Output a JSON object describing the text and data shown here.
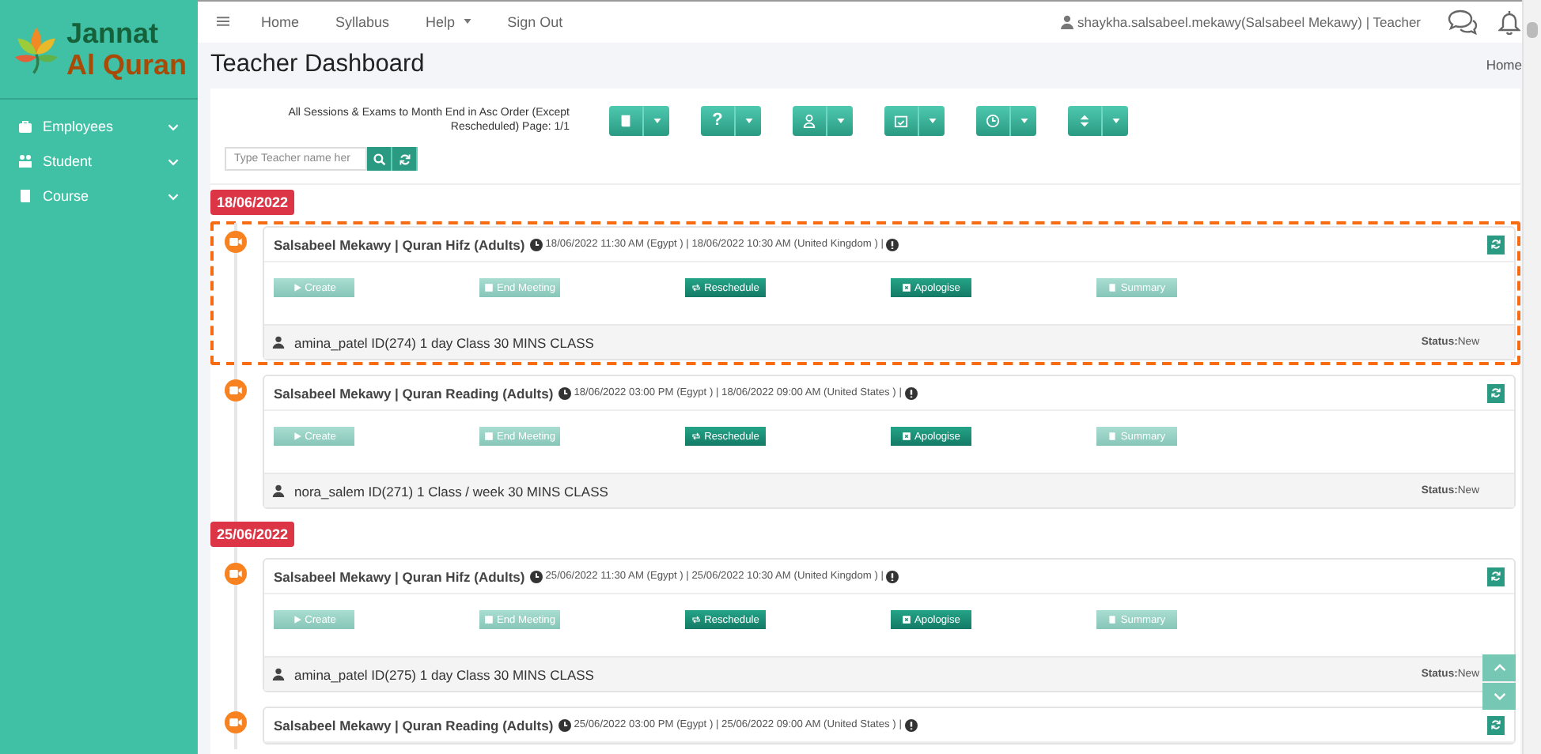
{
  "logo": {
    "line_1": "Jannat",
    "line_2": "Al Quran"
  },
  "sidebar": {
    "items": [
      {
        "label": "Employees",
        "kind": "briefcase"
      },
      {
        "label": "Student",
        "kind": "people"
      },
      {
        "label": "Course",
        "kind": "book"
      }
    ]
  },
  "nav": {
    "links": [
      {
        "label": "Home",
        "dropdown": false
      },
      {
        "label": "Syllabus",
        "dropdown": false
      },
      {
        "label": "Help",
        "dropdown": true
      },
      {
        "label": "Sign Out",
        "dropdown": false
      }
    ],
    "user": "shaykha.salsabeel.mekawy(Salsabeel Mekawy) | Teacher"
  },
  "page": {
    "title": "Teacher Dashboard",
    "breadcrumb": "Home"
  },
  "toolbar": {
    "caption": "All Sessions & Exams to Month End in Asc Order (Except Rescheduled) Page: 1/1",
    "groups": [
      {
        "kind": "book"
      },
      {
        "kind": "help",
        "label": "?"
      },
      {
        "kind": "user"
      },
      {
        "kind": "calendar"
      },
      {
        "kind": "clock"
      },
      {
        "kind": "sort"
      }
    ]
  },
  "search": {
    "placeholder": "Type Teacher name her"
  },
  "days": [
    {
      "date": "18/06/2022",
      "sessions": [
        {
          "highlighted": true,
          "title": "Salsabeel Mekawy | Quran Hifz (Adults)",
          "time": "18/06/2022 11:30 AM (Egypt ) | 18/06/2022 10:30 AM (United Kingdom ) |",
          "buttons": [
            {
              "label": "Create",
              "kind": "play",
              "disabled": true
            },
            {
              "label": "End Meeting",
              "kind": "stop",
              "disabled": true
            },
            {
              "label": "Reschedule",
              "kind": "repeat",
              "disabled": false
            },
            {
              "label": "Apologise",
              "kind": "cancel",
              "disabled": false
            },
            {
              "label": "Summary",
              "kind": "book",
              "disabled": true
            }
          ],
          "student": "amina_patel ID(274) 1 day Class 30 MINS CLASS",
          "status": "**Status:**New"
        },
        {
          "highlighted": false,
          "title": "Salsabeel Mekawy | Quran Reading (Adults)",
          "time": "18/06/2022 03:00 PM (Egypt ) | 18/06/2022 09:00 AM (United States ) |",
          "buttons": [
            {
              "label": "Create",
              "kind": "play",
              "disabled": true
            },
            {
              "label": "End Meeting",
              "kind": "stop",
              "disabled": true
            },
            {
              "label": "Reschedule",
              "kind": "repeat",
              "disabled": false
            },
            {
              "label": "Apologise",
              "kind": "cancel",
              "disabled": false
            },
            {
              "label": "Summary",
              "kind": "book",
              "disabled": true
            }
          ],
          "student": "nora_salem ID(271) 1 Class / week 30 MINS CLASS",
          "status": "**Status:**New"
        }
      ]
    },
    {
      "date": "25/06/2022",
      "sessions": [
        {
          "highlighted": false,
          "title": "Salsabeel Mekawy | Quran Hifz (Adults)",
          "time": "25/06/2022 11:30 AM (Egypt ) | 25/06/2022 10:30 AM (United Kingdom ) |",
          "buttons": [
            {
              "label": "Create",
              "kind": "play",
              "disabled": true
            },
            {
              "label": "End Meeting",
              "kind": "stop",
              "disabled": true
            },
            {
              "label": "Reschedule",
              "kind": "repeat",
              "disabled": false
            },
            {
              "label": "Apologise",
              "kind": "cancel",
              "disabled": false
            },
            {
              "label": "Summary",
              "kind": "book",
              "disabled": true
            }
          ],
          "student": "amina_patel ID(275) 1 day Class 30 MINS CLASS",
          "status": "**Status:**New"
        },
        {
          "highlighted": false,
          "title": "Salsabeel Mekawy | Quran Reading (Adults)",
          "time": "25/06/2022 03:00 PM (Egypt ) | 25/06/2022 09:00 AM (United States ) |"
        }
      ]
    }
  ]
}
